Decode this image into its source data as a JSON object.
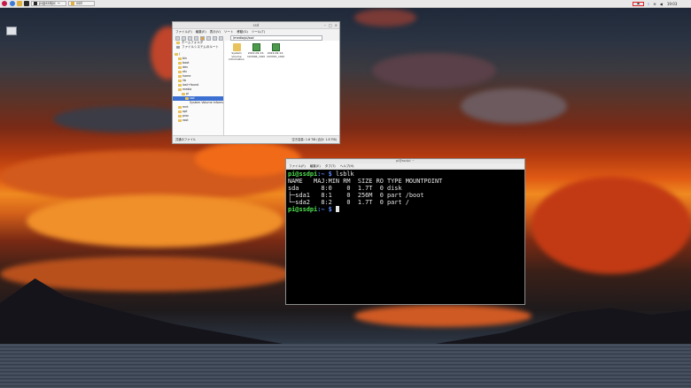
{
  "taskbar": {
    "tasks": [
      {
        "label": "pi@ssdpi: ~"
      },
      {
        "label": "ssd"
      }
    ],
    "clock": "19:03",
    "highlight_color": "#e0202a"
  },
  "desktop": {
    "icons": [
      {
        "label": ""
      }
    ]
  },
  "file_manager": {
    "title": "ssd",
    "menu": [
      "ファイル(F)",
      "編集(E)",
      "表示(V)",
      "ソート",
      "移動(G)",
      "ツール(T)"
    ],
    "path": "/media/pi/ssd",
    "places": [
      "ホームフォルダ",
      "ファイルシステムのルート"
    ],
    "tree": [
      {
        "label": "/",
        "depth": 0
      },
      {
        "label": "bin",
        "depth": 1
      },
      {
        "label": "boot",
        "depth": 1
      },
      {
        "label": "dev",
        "depth": 1
      },
      {
        "label": "etc",
        "depth": 1
      },
      {
        "label": "home",
        "depth": 1
      },
      {
        "label": "lib",
        "depth": 1
      },
      {
        "label": "lost+found",
        "depth": 1
      },
      {
        "label": "media",
        "depth": 1
      },
      {
        "label": "pi",
        "depth": 2
      },
      {
        "label": "ssd",
        "depth": 3,
        "selected": true
      },
      {
        "label": "System Volume Information",
        "depth": 4
      },
      {
        "label": "mnt",
        "depth": 1
      },
      {
        "label": "opt",
        "depth": 1
      },
      {
        "label": "proc",
        "depth": 1
      },
      {
        "label": "root",
        "depth": 1
      }
    ],
    "files": [
      {
        "name": "System Volume Information",
        "type": "folder"
      },
      {
        "name": "2022-09-13-103306_1920x1080_scrot.png",
        "type": "image"
      },
      {
        "name": "2022-09-13-103315_1920x1080_scrot.png",
        "type": "image"
      }
    ],
    "status_left": "共通のファイル",
    "status_right": "空き容量: 1.6 TiB (合計: 1.8 TiB)"
  },
  "terminal": {
    "title": "pi@ssdpi: ~",
    "menu": [
      "ファイル(F)",
      "編集(E)",
      "タブ(T)",
      "ヘルプ(H)"
    ],
    "prompt_user": "pi@ssdpi",
    "prompt_path": ":~ $ ",
    "command": "lsblk",
    "output": [
      "NAME   MAJ:MIN RM  SIZE RO TYPE MOUNTPOINT",
      "sda      8:0    0  1.7T  0 disk",
      "├─sda1   8:1    0  256M  0 part /boot",
      "└─sda2   8:2    0  1.7T  0 part /"
    ]
  }
}
